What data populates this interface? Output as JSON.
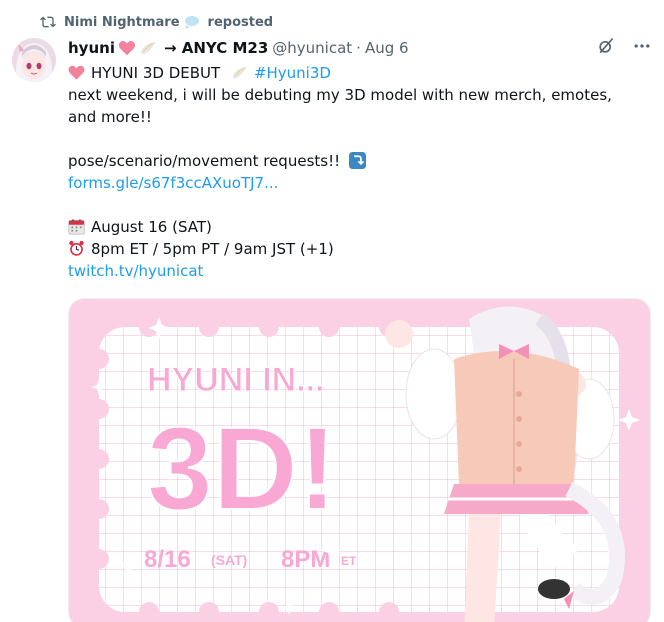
{
  "repost": {
    "user": "Nimi Nightmare",
    "cloud_emoji": "💭",
    "label": "reposted"
  },
  "author": {
    "display_name": "hyuni",
    "arrow_text": "→ ANYC M23",
    "handle": "@hyunicat",
    "separator": "·",
    "date": "Aug 6"
  },
  "post": {
    "title": "HYUNI 3D DEBUT",
    "hashtag": "#Hyuni3D",
    "line2": "next weekend, i will be debuting my 3D model with new merch, emotes,",
    "line3": "and more!!",
    "line5": "pose/scenario/movement requests!!",
    "link1": "forms.gle/s67f3ccAXuoTJ7...",
    "date_line": "August 16 (SAT)",
    "time_line": "8pm ET / 5pm PT / 9am JST (+1)",
    "link2": "twitch.tv/hyunicat"
  },
  "media": {
    "headline": "HYUNI IN...",
    "big_text": "3D!",
    "date_text": "8/16",
    "day_text": "(SAT)",
    "time_text": "8PM",
    "tz_text": "ET"
  },
  "colors": {
    "link": "#1d9bf0",
    "secondary": "#536471",
    "pink_bg": "#fbcfe4",
    "pink_text": "#f9a8d4"
  },
  "icons": [
    "repost-icon",
    "heart-icon",
    "wing-icon",
    "calendar-icon",
    "alarm-clock-icon",
    "down-arrow-icon",
    "grok-icon",
    "more-icon"
  ]
}
